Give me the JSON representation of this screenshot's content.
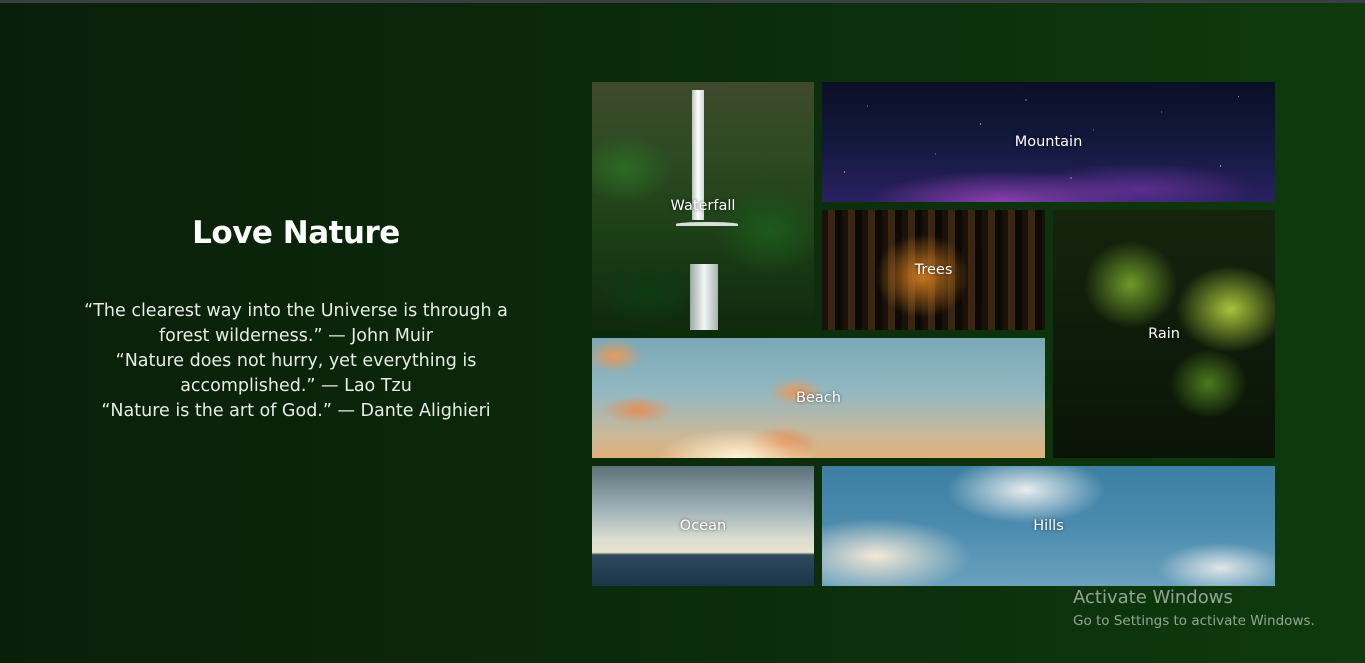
{
  "heading": "Love Nature",
  "quotes": [
    "“The clearest way into the Universe is through a forest wilderness.” — John Muir",
    "“Nature does not hurry, yet everything is accomplished.” — Lao Tzu",
    "“Nature is the art of God.” — Dante Alighieri"
  ],
  "gallery": {
    "waterfall": "Waterfall",
    "mountain": "Mountain",
    "trees": "Trees",
    "rain": "Rain",
    "beach": "Beach",
    "ocean": "Ocean",
    "hills": "Hills"
  },
  "watermark": {
    "title": "Activate Windows",
    "subtitle": "Go to Settings to activate Windows."
  },
  "colors": {
    "background_left": "#0a1f0a",
    "background_right": "#0e3a0e",
    "text": "#ffffff"
  }
}
